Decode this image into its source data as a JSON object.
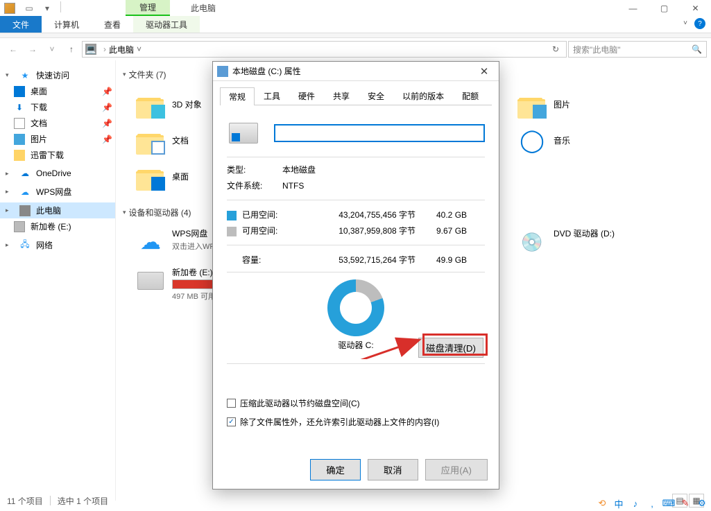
{
  "titlebar": {
    "context_tab": "管理",
    "title": "此电脑"
  },
  "ribbon": {
    "file": "文件",
    "tabs": [
      "计算机",
      "查看"
    ],
    "context_tab": "驱动器工具"
  },
  "address": {
    "location": "此电脑",
    "search_placeholder": "搜索\"此电脑\""
  },
  "sidebar": {
    "quick": {
      "label": "快速访问",
      "items": [
        {
          "name": "desktop",
          "label": "桌面",
          "pin": true
        },
        {
          "name": "downloads",
          "label": "下载",
          "pin": true
        },
        {
          "name": "documents",
          "label": "文档",
          "pin": true
        },
        {
          "name": "pictures",
          "label": "图片",
          "pin": true
        },
        {
          "name": "xunlei",
          "label": "迅雷下载",
          "pin": false
        }
      ]
    },
    "onedrive": "OneDrive",
    "wps": "WPS网盘",
    "thispc": "此电脑",
    "drive_e": "新加卷 (E:)",
    "network": "网络"
  },
  "content": {
    "folders_header": "文件夹 (7)",
    "folders": [
      {
        "name": "3d",
        "label": "3D 对象"
      },
      {
        "name": "pictures",
        "label": "图片"
      },
      {
        "name": "documents",
        "label": "文档"
      },
      {
        "name": "music",
        "label": "音乐"
      },
      {
        "name": "desktop",
        "label": "桌面"
      }
    ],
    "devices_header": "设备和驱动器 (4)",
    "devices": {
      "wps": {
        "title": "WPS网盘",
        "sub": "双击进入WPS…"
      },
      "dvd": {
        "title": "DVD 驱动器 (D:)"
      },
      "e": {
        "title": "新加卷 (E:)",
        "sub": "497 MB 可用"
      }
    }
  },
  "dialog": {
    "title": "本地磁盘 (C:) 属性",
    "tabs": [
      "常规",
      "工具",
      "硬件",
      "共享",
      "安全",
      "以前的版本",
      "配额"
    ],
    "type_label": "类型:",
    "type_value": "本地磁盘",
    "fs_label": "文件系统:",
    "fs_value": "NTFS",
    "used_label": "已用空间:",
    "used_bytes": "43,204,755,456 字节",
    "used_h": "40.2 GB",
    "free_label": "可用空间:",
    "free_bytes": "10,387,959,808 字节",
    "free_h": "9.67 GB",
    "cap_label": "容量:",
    "cap_bytes": "53,592,715,264 字节",
    "cap_h": "49.9 GB",
    "drive_label": "驱动器 C:",
    "cleanup_btn": "磁盘清理(D)",
    "chk1": "压缩此驱动器以节约磁盘空间(C)",
    "chk2": "除了文件属性外，还允许索引此驱动器上文件的内容(I)",
    "ok": "确定",
    "cancel": "取消",
    "apply": "应用(A)"
  },
  "statusbar": {
    "items": "11 个项目",
    "selected": "选中 1 个项目"
  }
}
